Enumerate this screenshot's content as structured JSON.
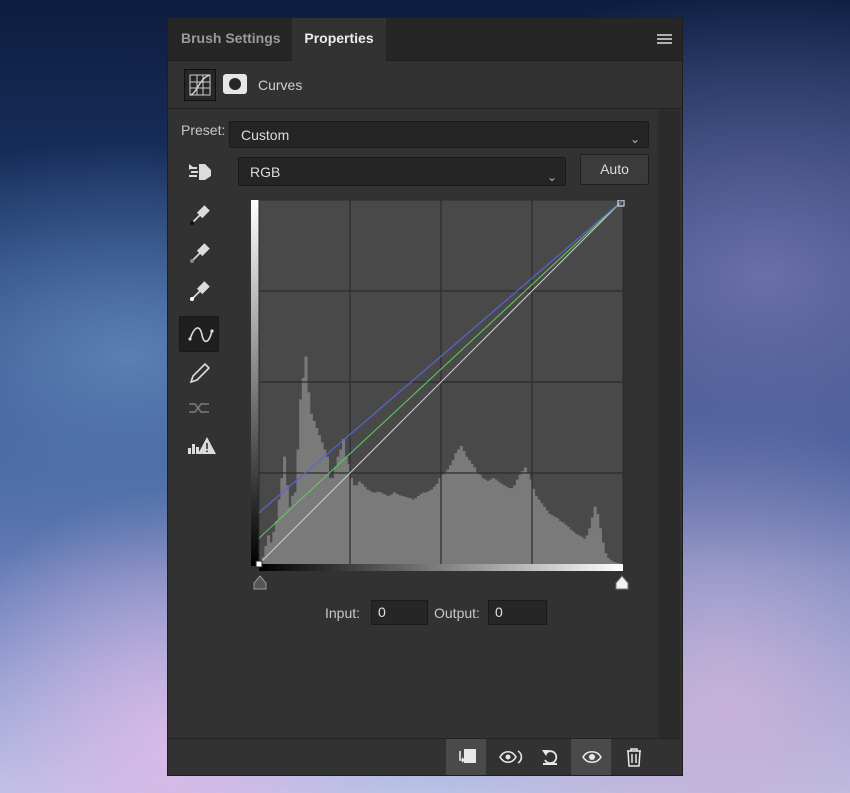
{
  "tabs": [
    {
      "label": "Brush Settings",
      "active": false
    },
    {
      "label": "Properties",
      "active": true
    }
  ],
  "adjustment": {
    "title": "Curves",
    "icons": [
      "curves-adjustment-icon",
      "layer-mask-icon"
    ]
  },
  "preset": {
    "label": "Preset:",
    "value": "Custom"
  },
  "channel": {
    "value": "RGB"
  },
  "auto_button": "Auto",
  "tools": [
    "on-image-adjust-icon",
    "black-point-eyedropper-icon",
    "gray-point-eyedropper-icon",
    "white-point-eyedropper-icon",
    "curve-points-icon",
    "pencil-draw-icon",
    "smooth-curve-icon",
    "clipping-warning-icon"
  ],
  "active_tool": "curve-points-icon",
  "curves": {
    "channels": [
      {
        "name": "RGB",
        "color": "#d0d0d0",
        "points": [
          [
            0,
            0
          ],
          [
            255,
            255
          ]
        ]
      },
      {
        "name": "Red",
        "color": "#4fb3d9",
        "points": [
          [
            0,
            36
          ],
          [
            255,
            255
          ]
        ]
      },
      {
        "name": "Green",
        "color": "#5fcf5f",
        "points": [
          [
            0,
            18
          ],
          [
            255,
            255
          ]
        ]
      },
      {
        "name": "Blue",
        "color": "#5a5ad6",
        "points": [
          [
            0,
            36
          ],
          [
            255,
            255
          ]
        ]
      }
    ],
    "histogram": [
      0,
      10,
      25,
      40,
      30,
      45,
      60,
      90,
      120,
      150,
      110,
      80,
      95,
      100,
      160,
      230,
      260,
      290,
      240,
      210,
      200,
      190,
      180,
      170,
      160,
      150,
      120,
      120,
      135,
      150,
      160,
      175,
      150,
      140,
      120,
      110,
      110,
      115,
      112,
      108,
      104,
      102,
      100,
      100,
      101,
      100,
      98,
      96,
      95,
      97,
      100,
      98,
      96,
      95,
      94,
      93,
      92,
      90,
      92,
      95,
      98,
      100,
      100,
      102,
      104,
      108,
      112,
      120,
      125,
      128,
      132,
      138,
      145,
      155,
      160,
      165,
      158,
      150,
      145,
      140,
      135,
      128,
      125,
      120,
      118,
      116,
      118,
      120,
      118,
      115,
      112,
      110,
      108,
      106,
      106,
      110,
      118,
      125,
      130,
      135,
      128,
      118,
      105,
      95,
      90,
      85,
      80,
      75,
      70,
      68,
      66,
      64,
      60,
      58,
      55,
      52,
      48,
      45,
      42,
      40,
      38,
      35,
      40,
      50,
      65,
      80,
      70,
      50,
      30,
      15,
      8,
      5,
      3,
      2,
      1,
      0
    ],
    "grid_divisions": 4
  },
  "input": {
    "label": "Input:",
    "value": "0"
  },
  "output": {
    "label": "Output:",
    "value": "0"
  },
  "bottom_actions": [
    "clip-to-layer-icon",
    "view-previous-state-icon",
    "reset-icon",
    "visibility-eye-icon",
    "delete-trash-icon"
  ],
  "colors": {
    "panel": "#323232",
    "tabbar": "#262626",
    "graph_bg": "#494949",
    "histogram": "#7a7a7a"
  }
}
